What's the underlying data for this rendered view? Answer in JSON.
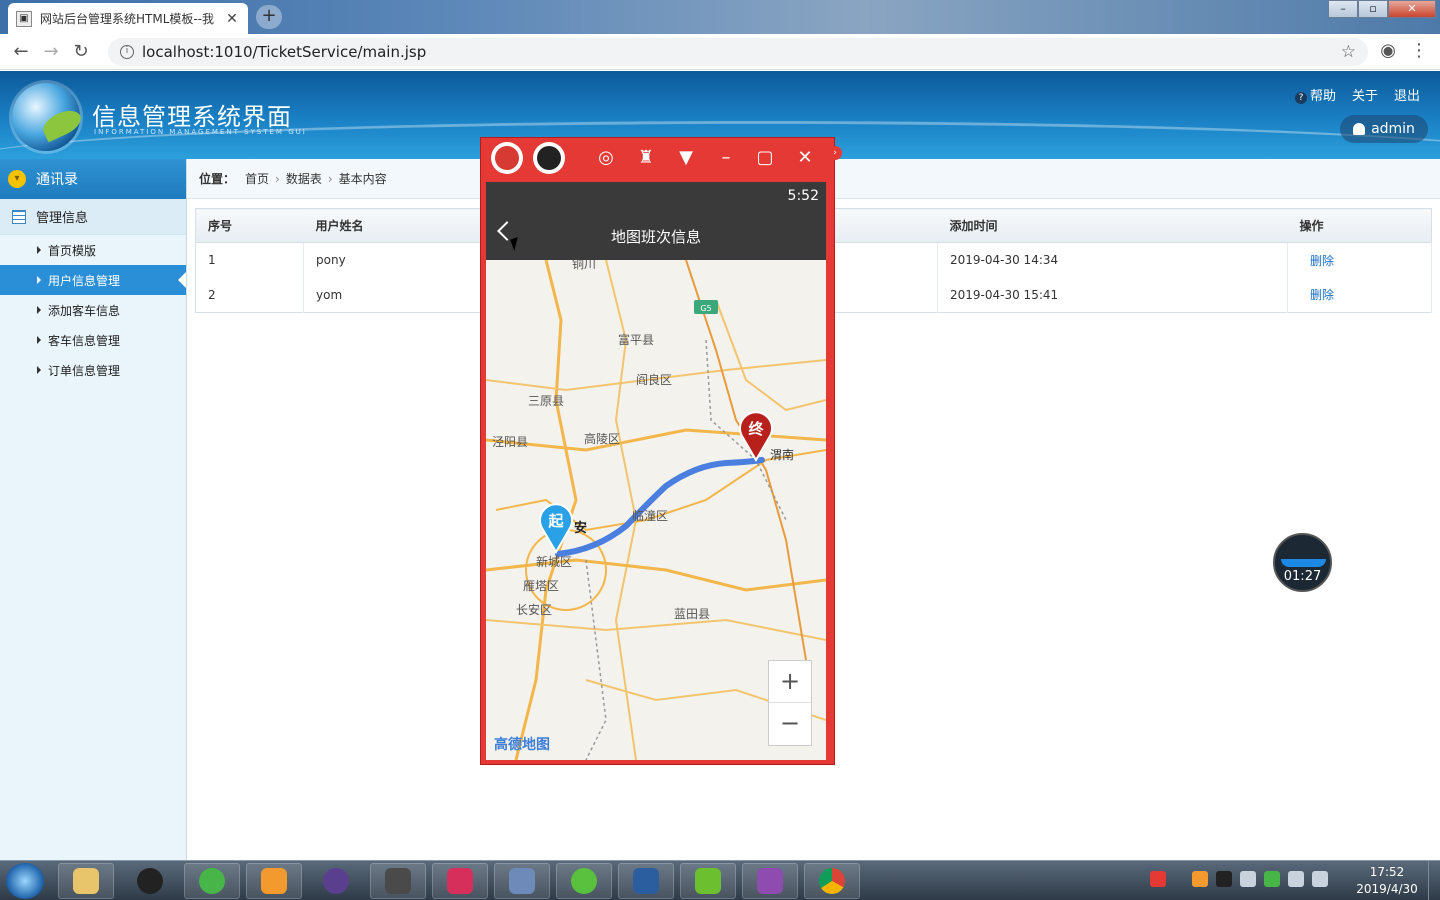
{
  "browser": {
    "tab_title": "网站后台管理系统HTML模板--我",
    "tab_close": "✕",
    "new_tab": "+",
    "url": "localhost:1010/TicketService/main.jsp",
    "window_controls": [
      "–",
      "▫",
      "✕"
    ]
  },
  "header": {
    "title": "信息管理系统界面",
    "subtitle": "INFORMATION MANAGEMENT SYSTEM GUI",
    "links": [
      "帮助",
      "关于",
      "退出"
    ],
    "user": "admin"
  },
  "sidebar": {
    "contacts": "通讯录",
    "manage": "管理信息",
    "items": [
      "首页模版",
      "用户信息管理",
      "添加客车信息",
      "客车信息管理",
      "订单信息管理"
    ],
    "active_index": 1
  },
  "breadcrumb": {
    "label": "位置：",
    "parts": [
      "首页",
      "数据表",
      "基本内容"
    ]
  },
  "table": {
    "headers": [
      "序号",
      "用户姓名",
      "添加时间",
      "操作"
    ],
    "rows": [
      {
        "id": "1",
        "name": "pony",
        "time": "2019-04-30 14:34",
        "op": "删除"
      },
      {
        "id": "2",
        "name": "yom",
        "time": "2019-04-30 15:41",
        "op": "删除"
      }
    ]
  },
  "emulator": {
    "status_time": "5:52",
    "app_title": "地图班次信息",
    "map_labels": [
      "铜川",
      "富平县",
      "阎良区",
      "三原县",
      "泾阳县",
      "高陵区",
      "渭南",
      "安",
      "临潼区",
      "新城区",
      "雁塔区",
      "长安区",
      "蓝田县",
      "G5"
    ],
    "start_marker": "起",
    "end_marker": "终",
    "zoom_in": "+",
    "zoom_out": "−",
    "map_brand": "高德地图",
    "colors": {
      "route": "#4a7fe0",
      "frame": "#e53935"
    }
  },
  "recorder": {
    "time": "01:27"
  },
  "taskbar": {
    "clock_time": "17:52",
    "clock_date": "2019/4/30"
  }
}
